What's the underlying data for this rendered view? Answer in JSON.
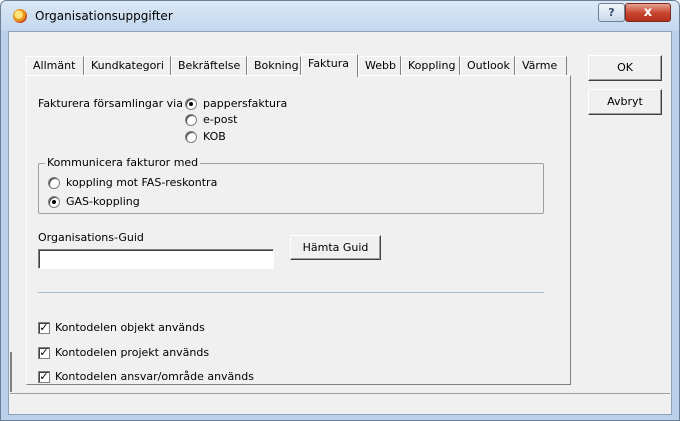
{
  "window": {
    "title": "Organisationsuppgifter",
    "help_glyph": "?",
    "close_glyph": "x"
  },
  "tabs": [
    {
      "label": "Allmänt",
      "active": false
    },
    {
      "label": "Kundkategori",
      "active": false
    },
    {
      "label": "Bekräftelse",
      "active": false
    },
    {
      "label": "Bokning",
      "active": false
    },
    {
      "label": "Faktura",
      "active": true
    },
    {
      "label": "Webb",
      "active": false
    },
    {
      "label": "Koppling",
      "active": false
    },
    {
      "label": "Outlook",
      "active": false
    },
    {
      "label": "Värme",
      "active": false
    }
  ],
  "invoice_via": {
    "label": "Fakturera församlingar via",
    "options": [
      {
        "label": "pappersfaktura",
        "checked": true
      },
      {
        "label": "e-post",
        "checked": false
      },
      {
        "label": "KOB",
        "checked": false
      }
    ]
  },
  "communicate": {
    "legend": "Kommunicera fakturor med",
    "options": [
      {
        "label": "koppling mot FAS-reskontra",
        "checked": false
      },
      {
        "label": "GAS-koppling",
        "checked": true
      }
    ]
  },
  "guid": {
    "label": "Organisations-Guid",
    "value": "",
    "fetch_button": "Hämta Guid"
  },
  "checkboxes": [
    {
      "label": "Kontodelen objekt används",
      "checked": true
    },
    {
      "label": "Kontodelen projekt används",
      "checked": true
    },
    {
      "label": "Kontodelen ansvar/område används",
      "checked": true
    }
  ],
  "buttons": {
    "ok": "OK",
    "cancel": "Avbryt"
  },
  "checkmark": "✓"
}
